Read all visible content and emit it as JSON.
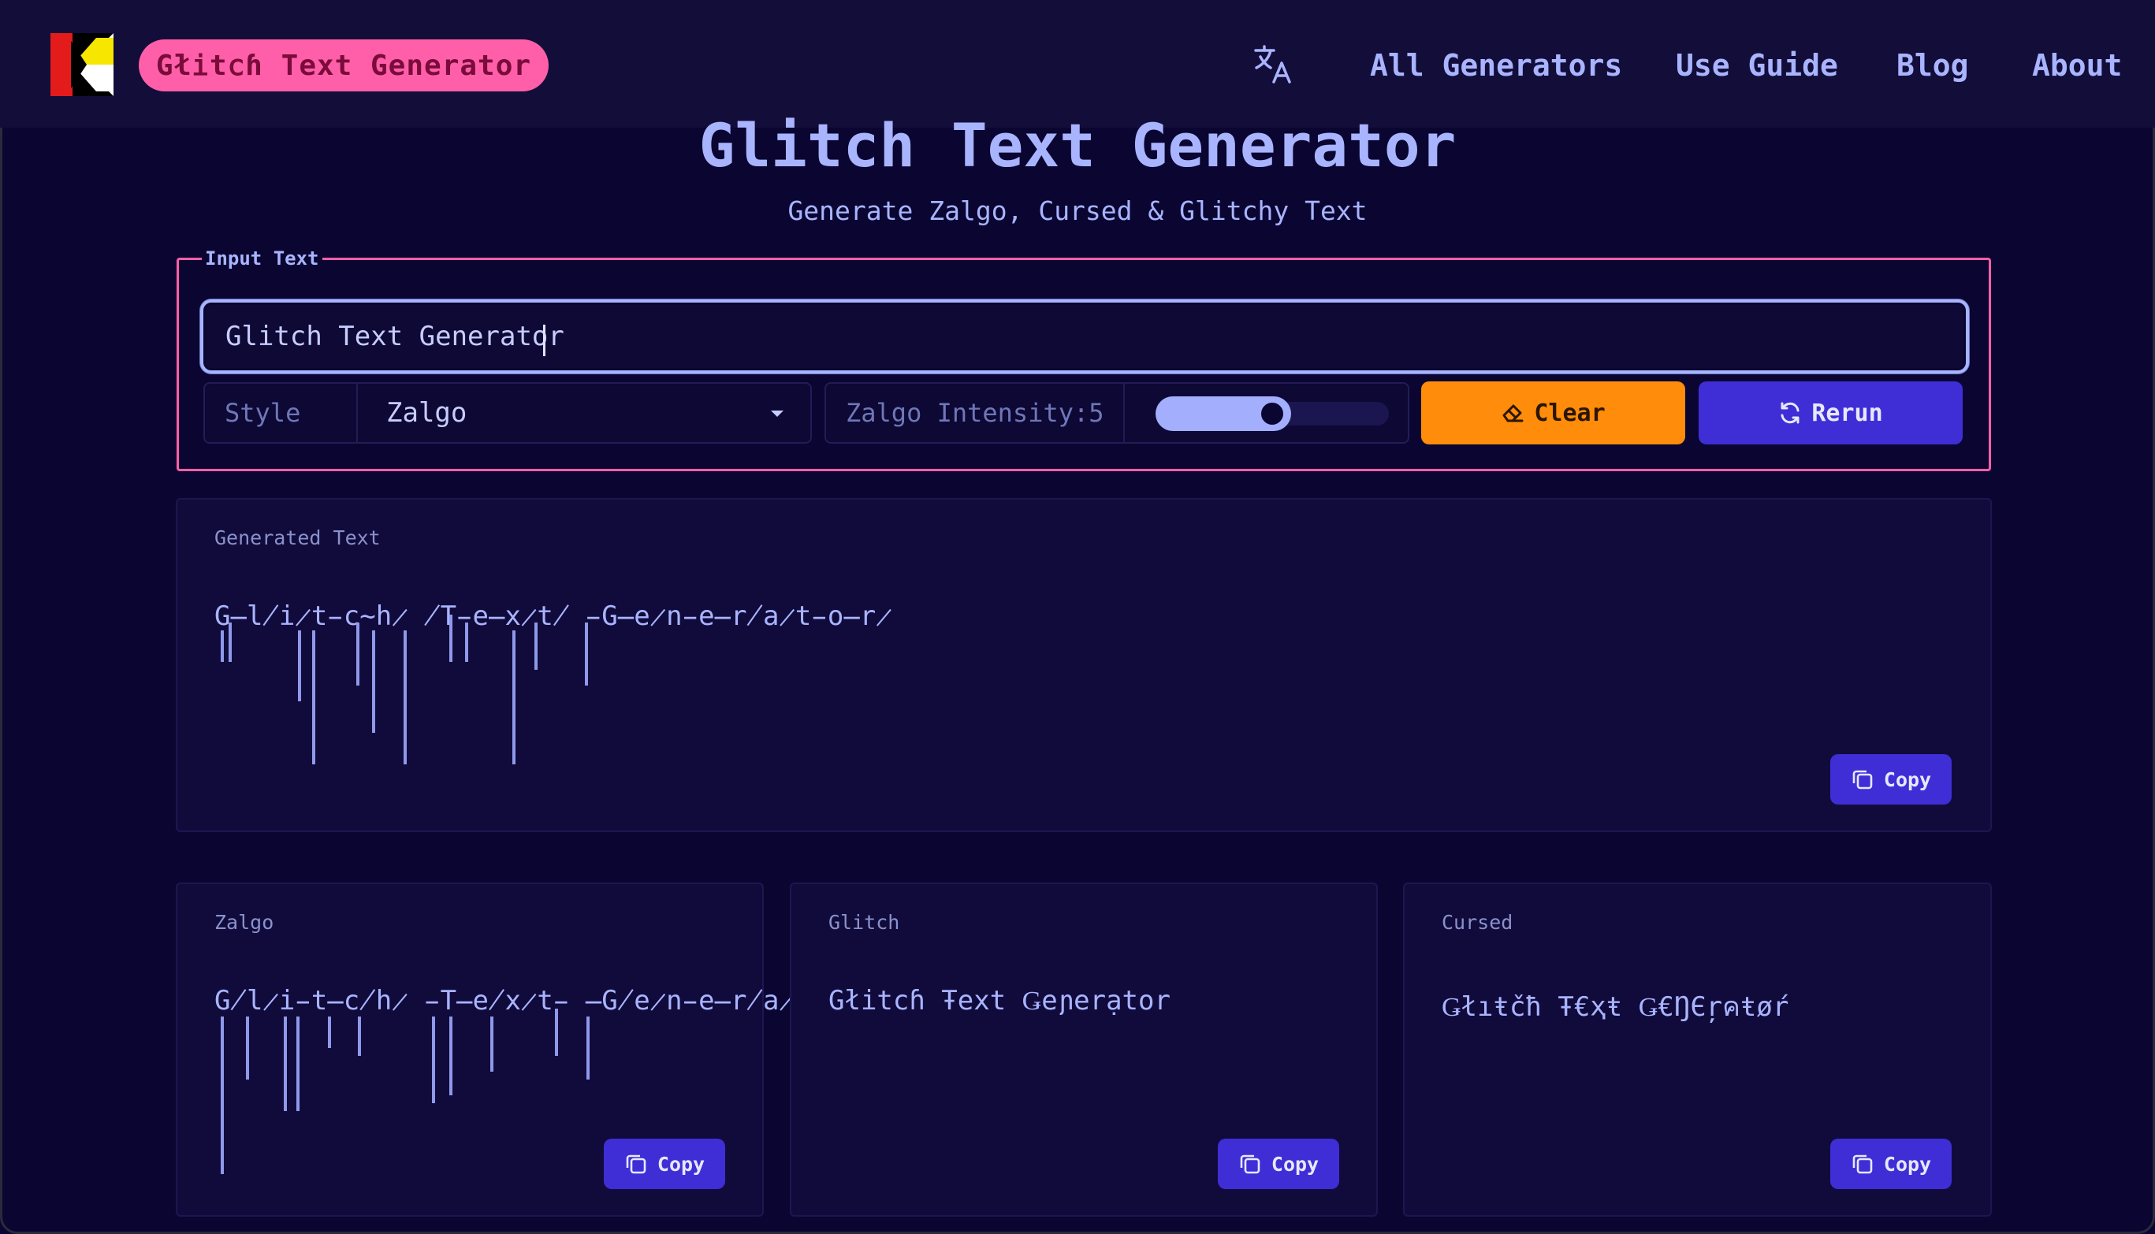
{
  "header": {
    "brand_label": "Gł𝚒t𝚌ɦ Text Generator",
    "translate_icon": "translate-icon",
    "nav": [
      "All Generators",
      "Use Guide",
      "Blog",
      "About"
    ]
  },
  "hero": {
    "title": "Glitch Text Generator",
    "subtitle": "Generate Zalgo, Cursed & Glitchy Text"
  },
  "input": {
    "legend": "Input Text",
    "value": "Glitch Text Generator",
    "style_label": "Style",
    "style_value": "Zalgo",
    "intensity_label": "Zalgo Intensity:5",
    "intensity_value": 5,
    "intensity_fraction": 0.5,
    "clear_label": "Clear",
    "rerun_label": "Rerun"
  },
  "generated": {
    "label": "Generated Text",
    "text": "G̶l̸i̷t̵c̴h̷ ̸T̵e̶x̷t̸ ̵G̶e̷n̵e̶r̸a̷t̵o̶r̷",
    "copy_label": "Copy"
  },
  "cards": [
    {
      "label": "Zalgo",
      "text": "G̸l̷i̵t̶c̸h̷ ̵T̶e̸x̷t̵ ̶G̸e̷n̵e̶r̸a̷t̵o̶r̷",
      "copy_label": "Copy"
    },
    {
      "label": "Glitch",
      "text": "Gł𝚒t𝚌ɦ Ŧ𝚎x𝚝 Ǥ𝚎ɲ𝚎𝚛ạ𝚝𝚘𝚛",
      "copy_label": "Copy"
    },
    {
      "label": "Cursed",
      "text": "Ǥłıŧčħ Ŧ€ҳŧ Ǥ€ŊЄŗคŧøŕ",
      "copy_label": "Copy"
    }
  ],
  "colors": {
    "background": "#0a0631",
    "accent_pink": "#ff5fa8",
    "accent_orange": "#ff8c0a",
    "accent_purple": "#3f2ed6",
    "text": "#a9b4ff"
  }
}
